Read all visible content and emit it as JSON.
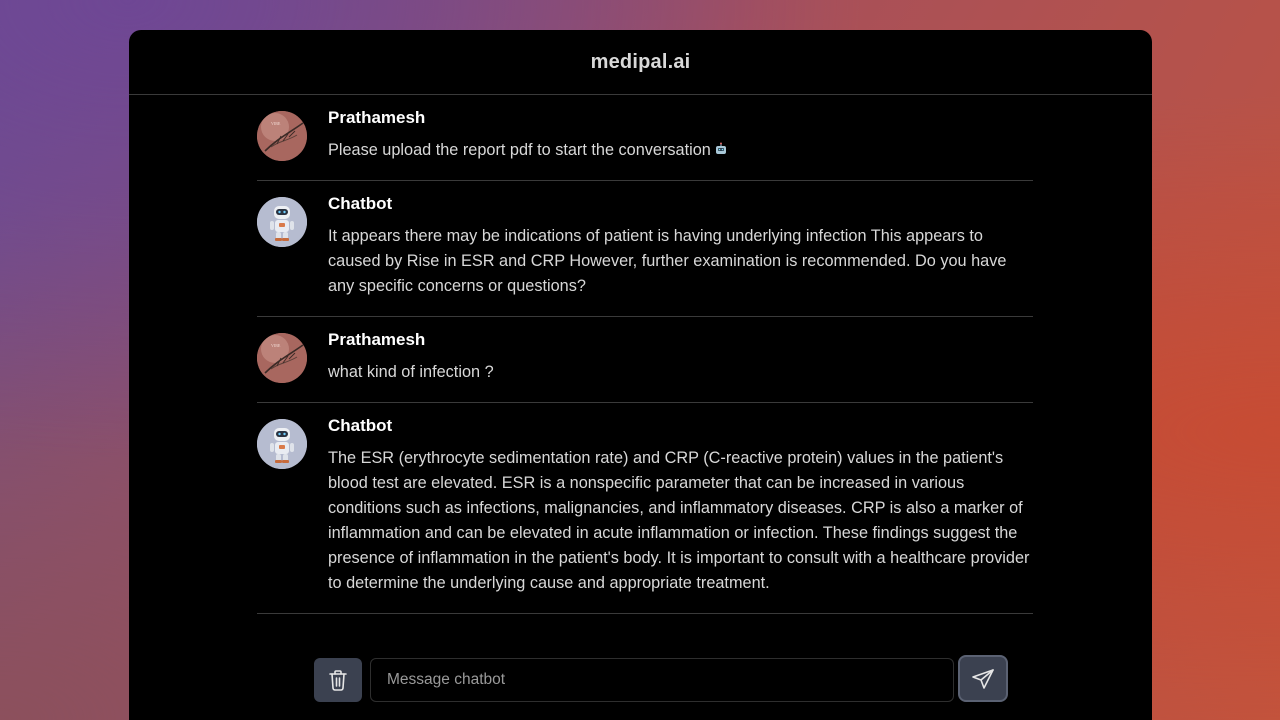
{
  "app": {
    "title": "medipal.ai"
  },
  "messages": [
    {
      "sender": "Prathamesh",
      "role": "user",
      "text": "Please upload the report pdf to start the conversation",
      "emoji": "robot-emoji"
    },
    {
      "sender": "Chatbot",
      "role": "bot",
      "text": "It appears there may be indications of patient is having underlying infection This appears to caused by Rise in ESR and CRP However, further examination is recommended. Do you have any specific concerns or questions?"
    },
    {
      "sender": "Prathamesh",
      "role": "user",
      "text": "what kind of infection ?"
    },
    {
      "sender": "Chatbot",
      "role": "bot",
      "text": "The ESR (erythrocyte sedimentation rate) and CRP (C-reactive protein) values in the patient's blood test are elevated. ESR is a nonspecific parameter that can be increased in various conditions such as infections, malignancies, and inflammatory diseases. CRP is also a marker of inflammation and can be elevated in acute inflammation or infection. These findings suggest the presence of inflammation in the patient's body. It is important to consult with a healthcare provider to determine the underlying cause and appropriate treatment."
    }
  ],
  "composer": {
    "placeholder": "Message chatbot",
    "value": "",
    "trash_icon": "trash-icon",
    "send_icon": "send-icon"
  },
  "colors": {
    "window_bg": "#000000",
    "divider": "#3a3a3a",
    "button_bg": "#3b4150",
    "text": "#d8d8d8"
  }
}
